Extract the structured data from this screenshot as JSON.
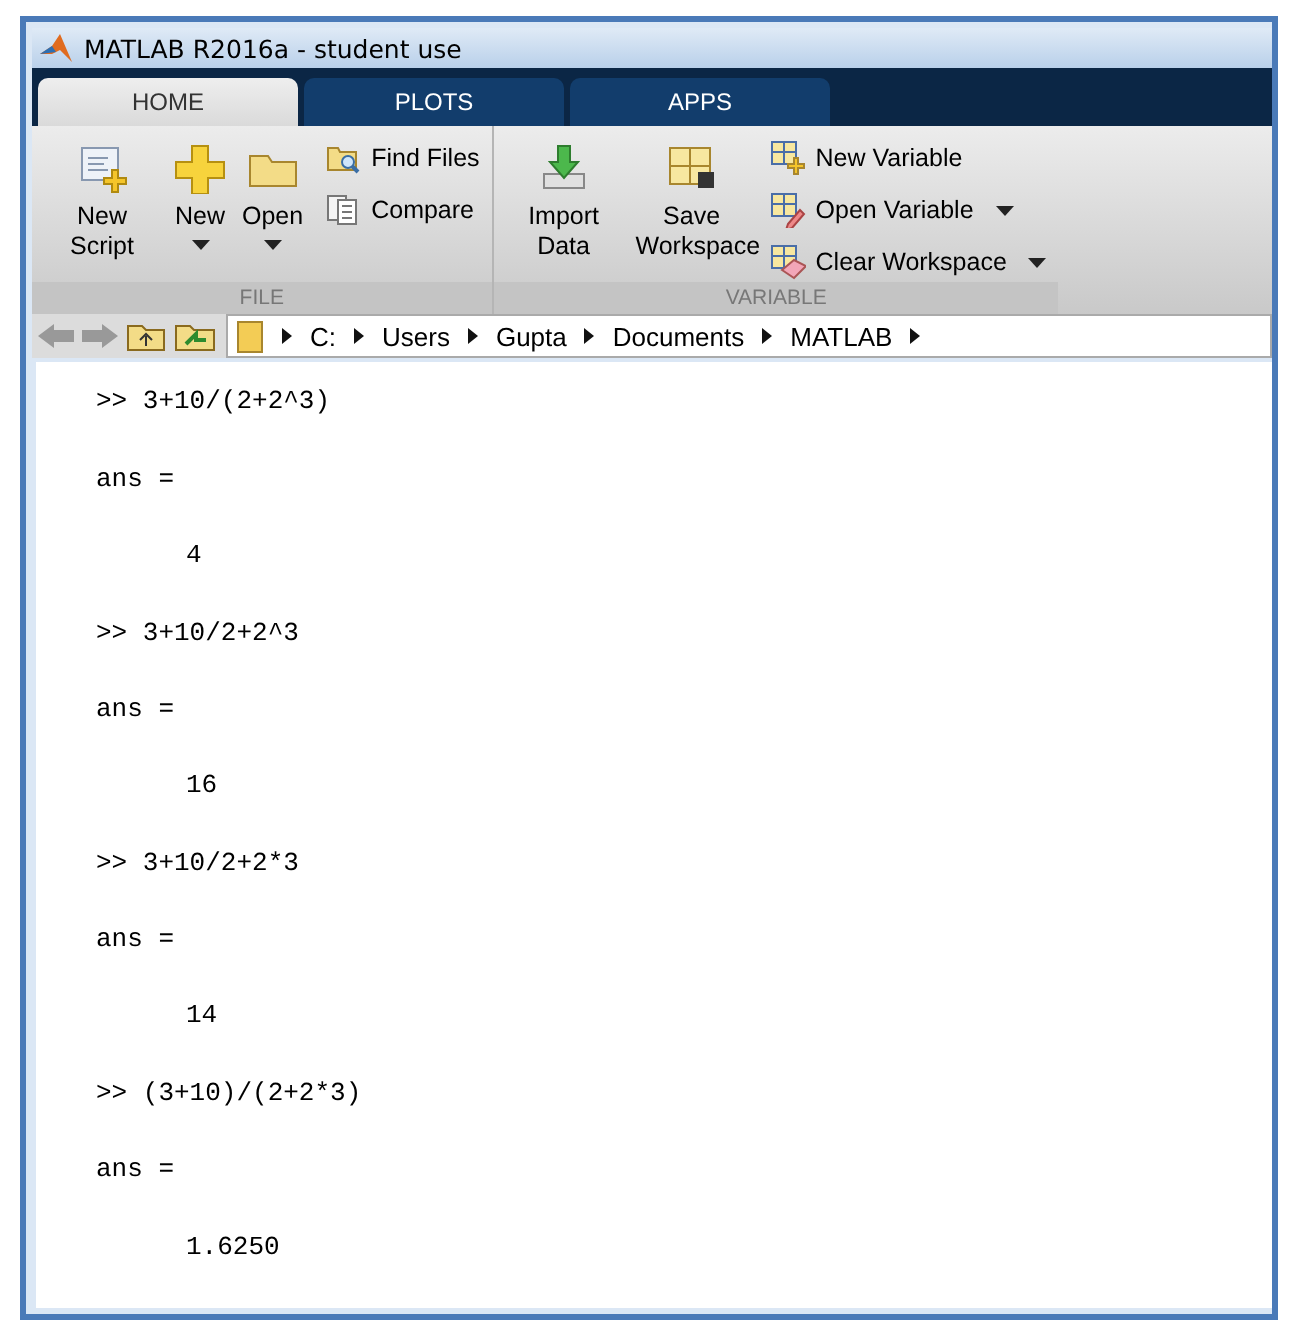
{
  "window": {
    "title": "MATLAB R2016a - student use"
  },
  "tabs": [
    {
      "label": "HOME",
      "selected": true
    },
    {
      "label": "PLOTS",
      "selected": false
    },
    {
      "label": "APPS",
      "selected": false
    }
  ],
  "ribbon": {
    "sections": [
      {
        "title": "FILE",
        "large": [
          {
            "label": "New Script",
            "dropdown": false
          },
          {
            "label": "New",
            "dropdown": true
          },
          {
            "label": "Open",
            "dropdown": true
          }
        ],
        "small": [
          {
            "label": "Find Files",
            "dropdown": false
          },
          {
            "label": "Compare",
            "dropdown": false
          }
        ]
      },
      {
        "title": "VARIABLE",
        "large": [
          {
            "label": "Import Data",
            "dropdown": false
          },
          {
            "label": "Save Workspace",
            "dropdown": false
          }
        ],
        "small": [
          {
            "label": "New Variable",
            "dropdown": false
          },
          {
            "label": "Open Variable",
            "dropdown": true
          },
          {
            "label": "Clear Workspace",
            "dropdown": true
          }
        ]
      }
    ]
  },
  "address": {
    "path": [
      "C:",
      "Users",
      "Gupta",
      "Documents",
      "MATLAB"
    ]
  },
  "console": {
    "lines": [
      {
        "kind": "command",
        "text": ">> 3+10/(2+2^3)"
      },
      {
        "kind": "output",
        "text": "ans ="
      },
      {
        "kind": "value",
        "text": "4"
      },
      {
        "kind": "command",
        "text": ">> 3+10/2+2^3"
      },
      {
        "kind": "output",
        "text": "ans ="
      },
      {
        "kind": "value",
        "text": "16"
      },
      {
        "kind": "command",
        "text": ">> 3+10/2+2*3"
      },
      {
        "kind": "output",
        "text": "ans ="
      },
      {
        "kind": "value",
        "text": "14"
      },
      {
        "kind": "command",
        "text": ">> (3+10)/(2+2*3)"
      },
      {
        "kind": "output",
        "text": "ans ="
      },
      {
        "kind": "value",
        "text": "1.6250"
      }
    ]
  }
}
